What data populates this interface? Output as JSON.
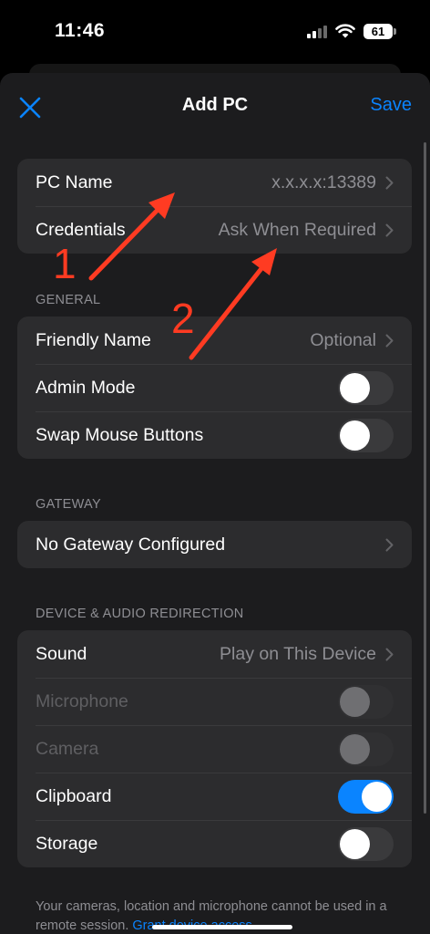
{
  "status_bar": {
    "time": "11:46",
    "battery": "61"
  },
  "nav": {
    "title": "Add PC",
    "save_label": "Save",
    "close_icon": "close-x-icon"
  },
  "pc_group": [
    {
      "label": "PC Name",
      "value": "x.x.x.x:13389"
    },
    {
      "label": "Credentials",
      "value": "Ask When Required"
    }
  ],
  "general": {
    "header": "GENERAL",
    "friendly_name": {
      "label": "Friendly Name",
      "value": "Optional"
    },
    "admin_mode": {
      "label": "Admin Mode",
      "on": false
    },
    "swap_mouse": {
      "label": "Swap Mouse Buttons",
      "on": false
    }
  },
  "gateway": {
    "header": "GATEWAY",
    "row_label": "No Gateway Configured"
  },
  "redirection": {
    "header": "DEVICE & AUDIO REDIRECTION",
    "sound": {
      "label": "Sound",
      "value": "Play on This Device"
    },
    "microphone": {
      "label": "Microphone",
      "on": false,
      "enabled": false
    },
    "camera": {
      "label": "Camera",
      "on": false,
      "enabled": false
    },
    "clipboard": {
      "label": "Clipboard",
      "on": true
    },
    "storage": {
      "label": "Storage",
      "on": false
    }
  },
  "footer": {
    "text": "Your cameras, location and microphone cannot be used in a remote session.",
    "link": "Grant device access."
  },
  "annotations": {
    "label_1": "1",
    "label_2": "2",
    "arrow_color": "#ff3b22"
  },
  "colors": {
    "accent": "#0a84ff",
    "background": "#1c1c1e",
    "cell": "#2c2c2e"
  }
}
